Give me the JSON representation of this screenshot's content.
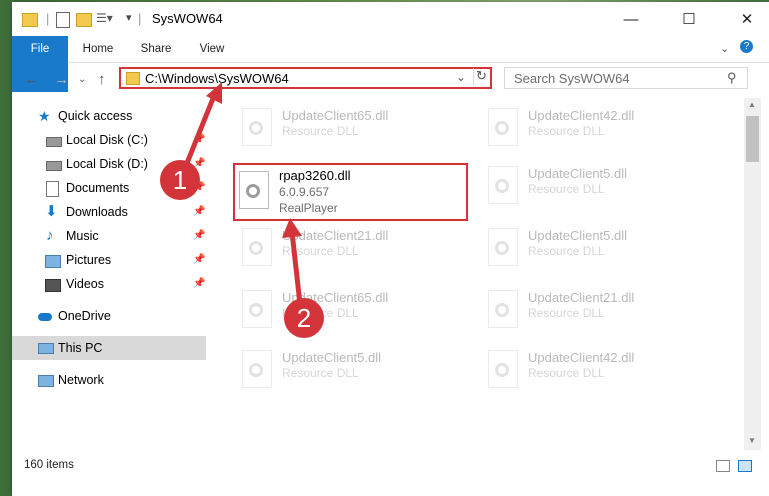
{
  "window": {
    "title": "SysWOW64"
  },
  "ribbon": {
    "tabs": [
      "File",
      "Home",
      "Share",
      "View"
    ]
  },
  "address": {
    "path": "C:\\Windows\\SysWOW64"
  },
  "search": {
    "placeholder": "Search SysWOW64"
  },
  "nav": {
    "items": [
      {
        "label": "Quick access",
        "icon": "star-icon"
      },
      {
        "label": "Local Disk (C:)",
        "icon": "drive-icon"
      },
      {
        "label": "Local Disk (D:)",
        "icon": "drive-icon"
      },
      {
        "label": "Documents",
        "icon": "documents-icon"
      },
      {
        "label": "Downloads",
        "icon": "download-icon"
      },
      {
        "label": "Music",
        "icon": "music-icon"
      },
      {
        "label": "Pictures",
        "icon": "pictures-icon"
      },
      {
        "label": "Videos",
        "icon": "videos-icon"
      },
      {
        "label": "OneDrive",
        "icon": "cloud-icon"
      },
      {
        "label": "This PC",
        "icon": "computer-icon"
      },
      {
        "label": "Network",
        "icon": "network-icon"
      }
    ]
  },
  "files": {
    "highlighted": {
      "name": "rpap3260.dll",
      "version": "6.0.9.657",
      "company": "RealPlayer"
    },
    "faded": [
      {
        "name": "UpdateClient65.dll",
        "type": "Resource DLL"
      },
      {
        "name": "UpdateClient42.dll",
        "type": "Resource DLL"
      },
      {
        "name": "UpdateClient5.dll",
        "type": "Resource DLL"
      },
      {
        "name": "UpdateClient21.dll",
        "type": "Resource DLL"
      },
      {
        "name": "UpdateClient5.dll",
        "type": "Resource DLL"
      },
      {
        "name": "UpdateClient65.dll",
        "type": "Resource DLL"
      },
      {
        "name": "UpdateClient21.dll",
        "type": "Resource DLL"
      },
      {
        "name": "UpdateClient5.dll",
        "type": "Resource DLL"
      },
      {
        "name": "UpdateClient42.dll",
        "type": "Resource DLL"
      }
    ]
  },
  "status": {
    "item_count": "160 items"
  },
  "callouts": {
    "one": "1",
    "two": "2"
  },
  "colors": {
    "accent": "#1979ca",
    "highlight": "#d3343a",
    "selected": "#d9d9d9"
  }
}
